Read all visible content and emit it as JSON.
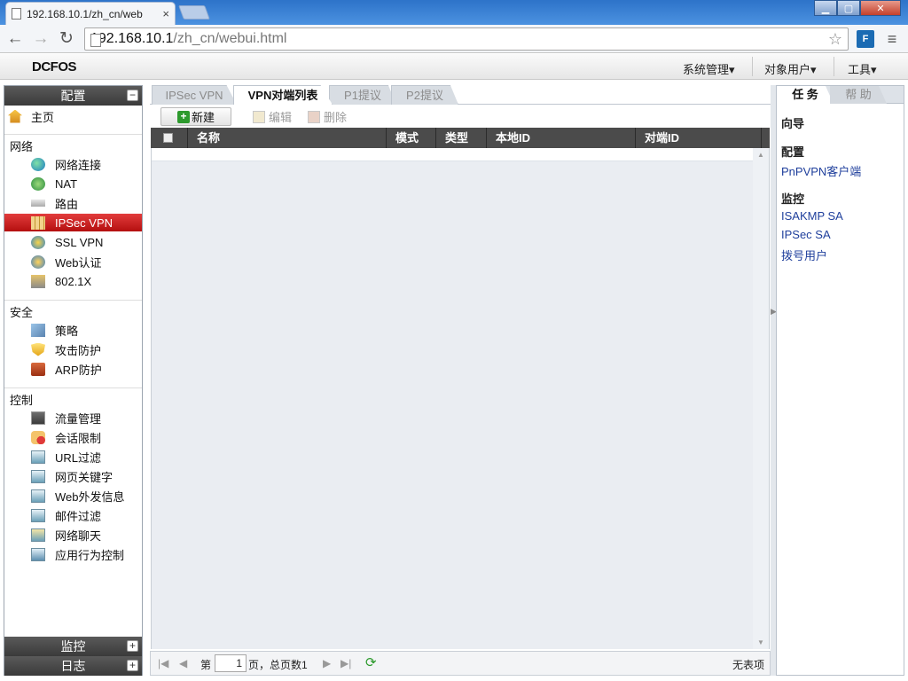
{
  "browser": {
    "tab_title": "192.168.10.1/zh_cn/web",
    "tab_close": "×",
    "url_host": "192.168.10.1",
    "url_path": "/zh_cn/webui.html"
  },
  "app": {
    "logo": "DCFOS",
    "top_menu": [
      "系统管理",
      "对象用户",
      "工具"
    ]
  },
  "sidebar": {
    "config_title": "配置",
    "config_toggle": "−",
    "home": "主页",
    "groups": {
      "network": "网络",
      "security": "安全",
      "control": "控制"
    },
    "network_items": [
      "网络连接",
      "NAT",
      "路由",
      "IPSec VPN",
      "SSL VPN",
      "Web认证",
      "802.1X"
    ],
    "security_items": [
      "策略",
      "攻击防护",
      "ARP防护"
    ],
    "control_items": [
      "流量管理",
      "会话限制",
      "URL过滤",
      "网页关键字",
      "Web外发信息",
      "邮件过滤",
      "网络聊天",
      "应用行为控制"
    ],
    "monitor_title": "监控",
    "log_title": "日志",
    "expand": "+"
  },
  "center": {
    "tabs": [
      "IPSec VPN",
      "VPN对端列表",
      "P1提议",
      "P2提议"
    ],
    "toolbar": {
      "new": "新建",
      "edit": "编辑",
      "delete": "删除"
    },
    "columns": [
      "名称",
      "模式",
      "类型",
      "本地ID",
      "对端ID"
    ],
    "pager": {
      "page_prefix": "第",
      "page_value": "1",
      "page_suffix": "页，总页数1",
      "empty": "无表项"
    }
  },
  "right": {
    "tabs": [
      "任 务",
      "帮 助"
    ],
    "wizard": "向导",
    "config": "配置",
    "config_links": [
      "PnPVPN客户端"
    ],
    "monitor": "监控",
    "monitor_links": [
      "ISAKMP SA",
      "IPSec SA",
      "拨号用户"
    ]
  },
  "colors": {
    "active_nav": "#c41414",
    "header_dark": "#4b4b4b",
    "link": "#1f3f9c"
  }
}
